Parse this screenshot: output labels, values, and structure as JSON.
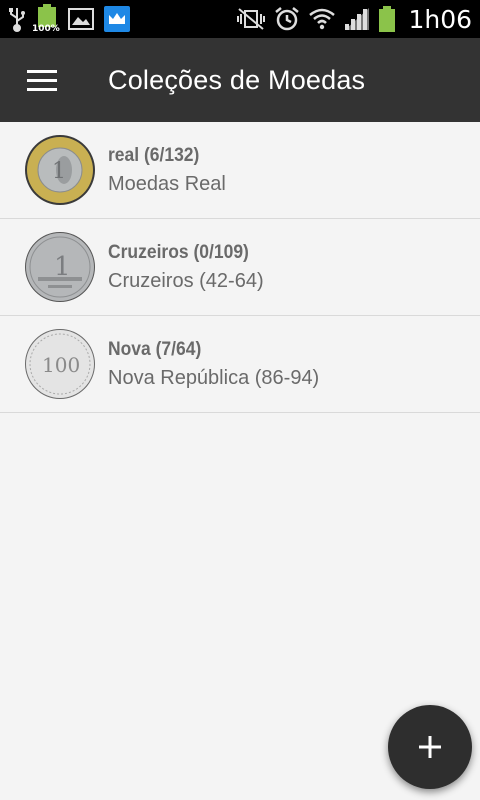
{
  "status_bar": {
    "time": "1h06",
    "battery_small_label": "100%"
  },
  "toolbar": {
    "title": "Coleções de Moedas"
  },
  "collections": [
    {
      "title": "real (6/132)",
      "subtitle": "Moedas Real",
      "coin_label": "1"
    },
    {
      "title": "Cruzeiros (0/109)",
      "subtitle": "Cruzeiros (42-64)",
      "coin_label": "1"
    },
    {
      "title": "Nova (7/64)",
      "subtitle": "Nova República (86-94)",
      "coin_label": "100"
    }
  ],
  "fab": {
    "label": "+"
  },
  "colors": {
    "toolbar": "#333333",
    "background": "#f4f4f4",
    "fab": "#2e2e2e",
    "battery": "#8bc34a"
  }
}
